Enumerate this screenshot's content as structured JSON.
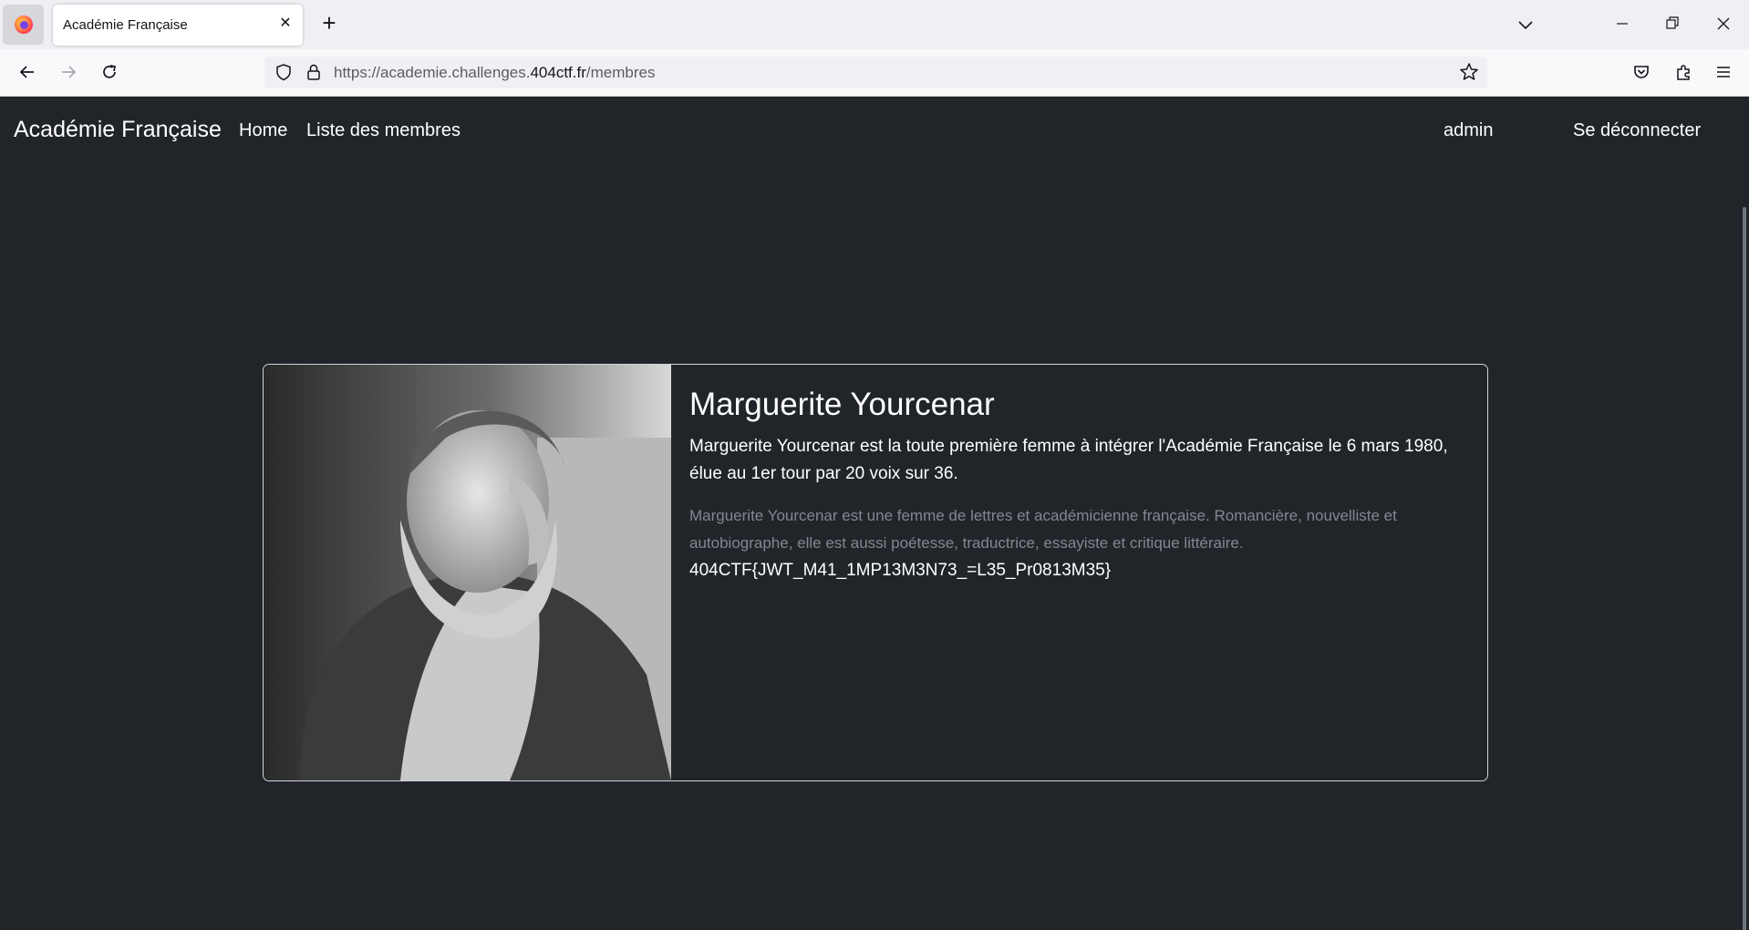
{
  "browser": {
    "tab_title": "Académie Française",
    "url_prefix": "https://academie.challenges.",
    "url_host": "404ctf.fr",
    "url_path": "/membres"
  },
  "site": {
    "brand": "Académie Française",
    "nav": {
      "home": "Home",
      "members": "Liste des membres",
      "user": "admin",
      "logout": "Se déconnecter"
    }
  },
  "card": {
    "title": "Marguerite Yourcenar",
    "text": "Marguerite Yourcenar est la toute première femme à intégrer l'Académie Française le 6 mars 1980, élue au 1er tour par 20 voix sur 36.",
    "muted": "Marguerite Yourcenar est une femme de lettres et académicienne française. Romancière, nouvelliste et autobiographe, elle est aussi poétesse, traductrice, essayiste et critique littéraire.",
    "flag": "404CTF{JWT_M41_1MP13M3N73_=L35_Pr0813M35}"
  }
}
